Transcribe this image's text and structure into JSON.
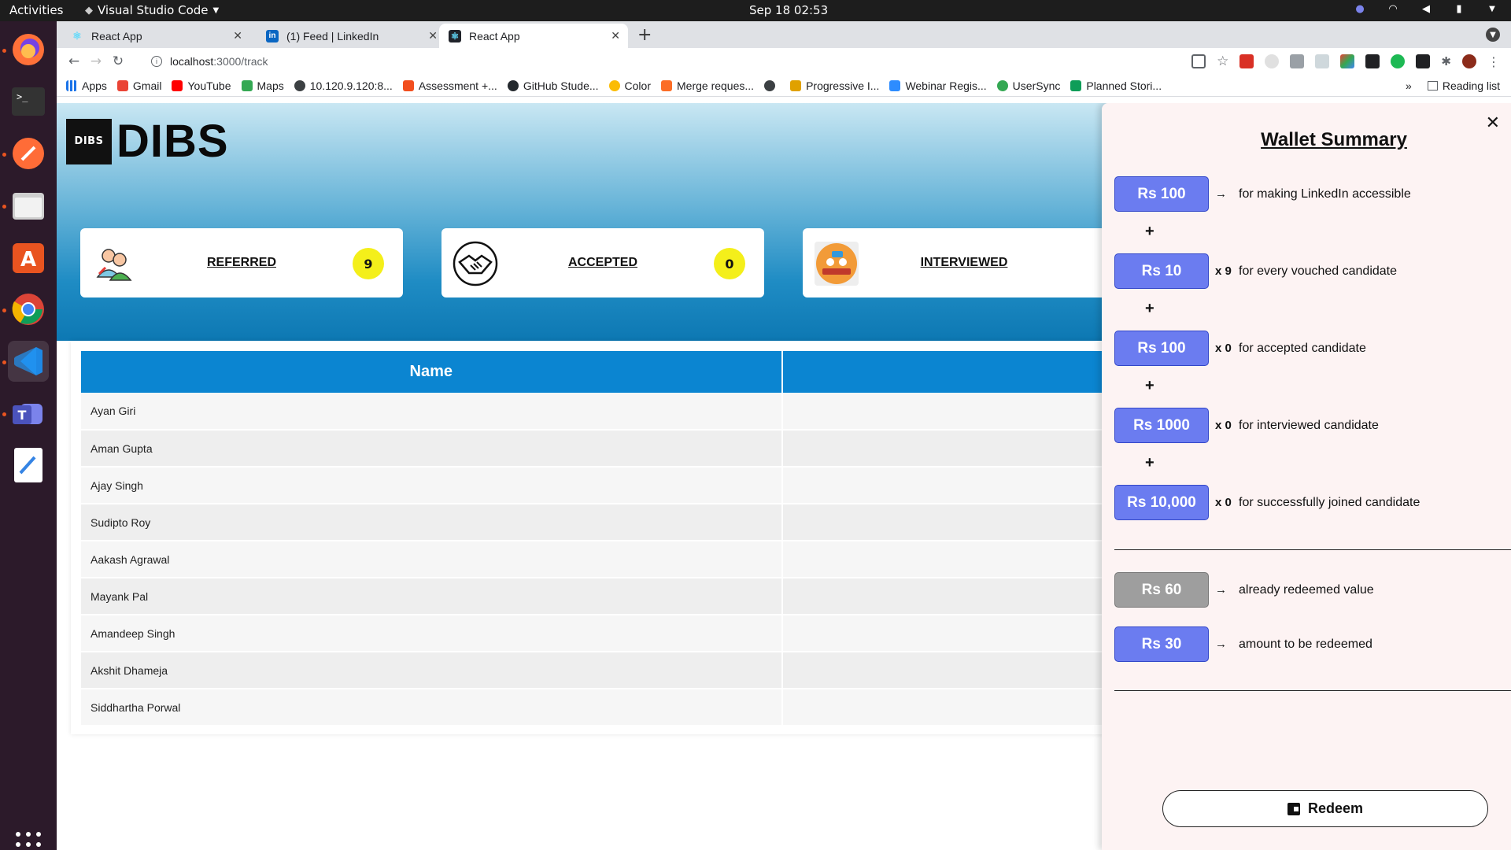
{
  "system": {
    "activities": "Activities",
    "app_menu": "Visual Studio Code",
    "clock": "Sep 18  02:53"
  },
  "tabs": [
    {
      "title": "React App",
      "active": false
    },
    {
      "title": "(1) Feed | LinkedIn",
      "active": false
    },
    {
      "title": "React App",
      "active": true
    }
  ],
  "address": {
    "host": "localhost",
    "path": ":3000/track"
  },
  "bookmarks": {
    "items": [
      "Apps",
      "Gmail",
      "YouTube",
      "Maps",
      "10.120.9.120:8...",
      "Assessment +...",
      "GitHub Stude...",
      "Color",
      "Merge reques...",
      "Progressive I...",
      "Webinar Regis...",
      "UserSync",
      "Planned Stori..."
    ],
    "more": "»",
    "reading_list": "Reading list"
  },
  "app": {
    "logo_badge": "DIBS",
    "logo_text": "DIBS"
  },
  "stats": [
    {
      "label": "REFERRED",
      "count": "9",
      "icon": "referred-people-icon"
    },
    {
      "label": "ACCEPTED",
      "count": "0",
      "icon": "handshake-icon"
    },
    {
      "label": "INTERVIEWED",
      "count": "",
      "icon": "interview-icon"
    }
  ],
  "table": {
    "header": "Name",
    "rows": [
      "Ayan Giri",
      "Aman Gupta",
      "Ajay Singh",
      "Sudipto Roy",
      "Aakash Agrawal",
      "Mayank Pal",
      "Amandeep Singh",
      "Akshit Dhameja",
      "Siddhartha Porwal"
    ]
  },
  "wallet": {
    "title": "Wallet Summary",
    "close": "✕",
    "rows": [
      {
        "amount": "Rs 100",
        "mult": "→",
        "desc": "for making LinkedIn accessible"
      },
      {
        "amount": "Rs 10",
        "mult": "x 9",
        "desc": "for every vouched candidate"
      },
      {
        "amount": "Rs 100",
        "mult": "x 0",
        "desc": "for accepted candidate"
      },
      {
        "amount": "Rs 1000",
        "mult": "x 0",
        "desc": "for interviewed candidate"
      },
      {
        "amount": "Rs 10,000",
        "mult": "x 0",
        "desc": "for successfully joined candidate"
      }
    ],
    "plus": "+",
    "redeemed": {
      "amount": "Rs 60",
      "mult": "→",
      "desc": "already redeemed value"
    },
    "to_redeem": {
      "amount": "Rs 30",
      "mult": "→",
      "desc": "amount to be redeemed"
    },
    "redeem_label": "Redeem"
  },
  "colors": {
    "accent": "#0b85d1",
    "pill": "#6b7cf0",
    "badge": "#f4ef1a",
    "drawer_bg": "#fdf3f3"
  }
}
